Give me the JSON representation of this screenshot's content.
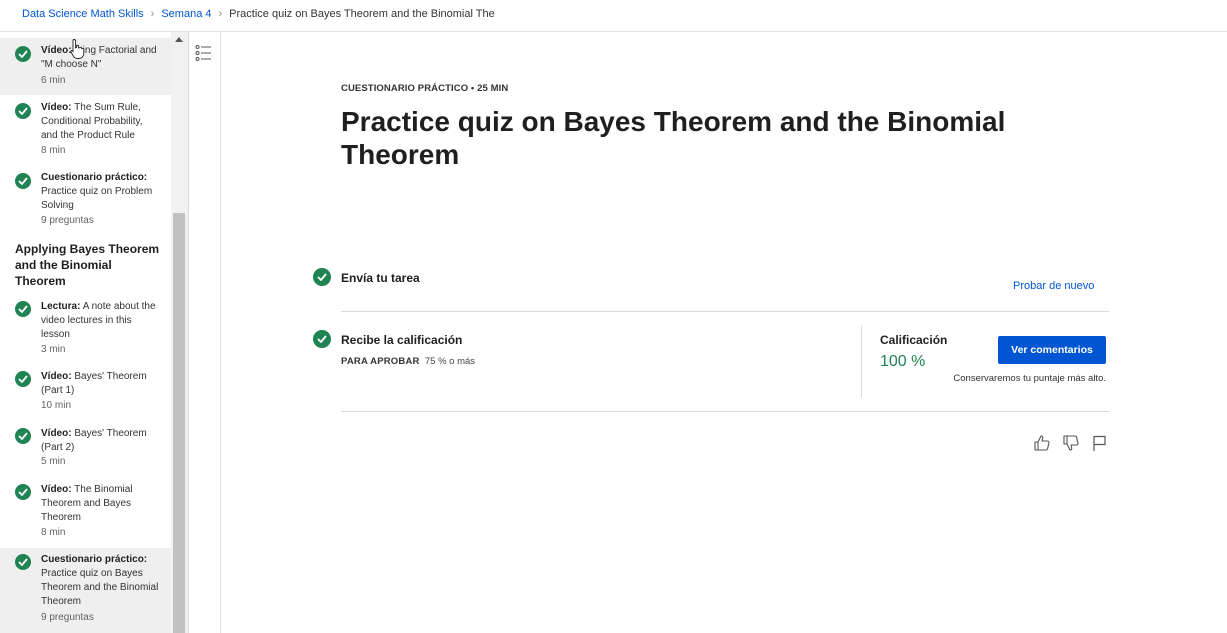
{
  "breadcrumb": {
    "course": "Data Science Math Skills",
    "week": "Semana 4",
    "current": "Practice quiz on Bayes Theorem and the Binomial The"
  },
  "sidebar": {
    "items": [
      {
        "type": "Vídeo:",
        "title": "...ing Factorial and \"M choose N\"",
        "meta": "6 min",
        "active": true
      },
      {
        "type": "Vídeo:",
        "title": "The Sum Rule, Conditional Probability, and the Product Rule",
        "meta": "8 min"
      },
      {
        "type": "Cuestionario práctico:",
        "title": "Practice quiz on Problem Solving",
        "meta": "9 preguntas"
      },
      {
        "type": "Lectura:",
        "title": "A note about the video lectures in this lesson",
        "meta": "3 min"
      },
      {
        "type": "Vídeo:",
        "title": "Bayes' Theorem (Part 1)",
        "meta": "10 min"
      },
      {
        "type": "Vídeo:",
        "title": "Bayes' Theorem (Part 2)",
        "meta": "5 min"
      },
      {
        "type": "Vídeo:",
        "title": "The Binomial Theorem and Bayes Theorem",
        "meta": "8 min"
      },
      {
        "type": "Cuestionario práctico:",
        "title": "Practice quiz on Bayes Theorem and the Binomial Theorem",
        "meta": "9 preguntas",
        "active": true
      }
    ],
    "section_title": "Applying Bayes Theorem and the Binomial Theorem"
  },
  "main": {
    "kicker": "CUESTIONARIO PRÁCTICO • 25 MIN",
    "title": "Practice quiz on Bayes Theorem and the Binomial Theorem",
    "submit_label": "Envía tu tarea",
    "retry_label": "Probar de nuevo",
    "receive_label": "Recibe la calificación",
    "pass_label": "PARA APROBAR",
    "pass_value": "75 % o más",
    "grade_label": "Calificación",
    "grade_value": "100 %",
    "feedback_button": "Ver comentarios",
    "keep_note": "Conservaremos tu puntaje más alto."
  },
  "colors": {
    "accent": "#0056d2",
    "success": "#1f8354"
  },
  "icons": [
    "check-icon",
    "toc-list-icon",
    "thumbs-up-icon",
    "thumbs-down-icon",
    "flag-icon",
    "hand-cursor-icon"
  ]
}
